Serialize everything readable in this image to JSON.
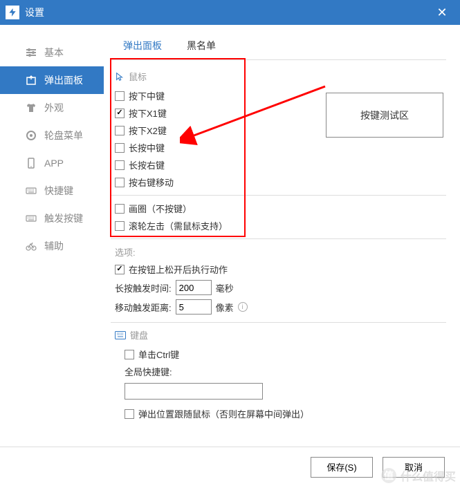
{
  "title": "设置",
  "sidebar": {
    "items": [
      {
        "label": "基本"
      },
      {
        "label": "弹出面板"
      },
      {
        "label": "外观"
      },
      {
        "label": "轮盘菜单"
      },
      {
        "label": "APP"
      },
      {
        "label": "快捷键"
      },
      {
        "label": "触发按键"
      },
      {
        "label": "辅助"
      }
    ]
  },
  "tabs": [
    {
      "label": "弹出面板"
    },
    {
      "label": "黑名单"
    }
  ],
  "mouse_section": {
    "title": "鼠标",
    "items": [
      {
        "label": "按下中键",
        "checked": false
      },
      {
        "label": "按下X1键",
        "checked": true
      },
      {
        "label": "按下X2键",
        "checked": false
      },
      {
        "label": "长按中键",
        "checked": false
      },
      {
        "label": "长按右键",
        "checked": false
      },
      {
        "label": "按右键移动",
        "checked": false
      }
    ],
    "extra": [
      {
        "label": "画圈（不按键）",
        "checked": false
      },
      {
        "label": "滚轮左击（需鼠标支持）",
        "checked": false
      }
    ]
  },
  "options": {
    "title": "选项:",
    "release_action": {
      "label": "在按钮上松开后执行动作",
      "checked": true
    },
    "longpress_label": "长按触发时间:",
    "longpress_value": "200",
    "longpress_unit": "毫秒",
    "move_label": "移动触发距离:",
    "move_value": "5",
    "move_unit": "像素"
  },
  "keyboard_section": {
    "title": "键盘",
    "ctrl": {
      "label": "单击Ctrl键",
      "checked": false
    },
    "hotkey_label": "全局快捷键:",
    "follow_mouse": {
      "label": "弹出位置跟随鼠标（否则在屏幕中间弹出）",
      "checked": false
    }
  },
  "test_area": "按键测试区",
  "footer": {
    "save": "保存(S)",
    "cancel": "取消"
  },
  "watermark": "什么值得买"
}
